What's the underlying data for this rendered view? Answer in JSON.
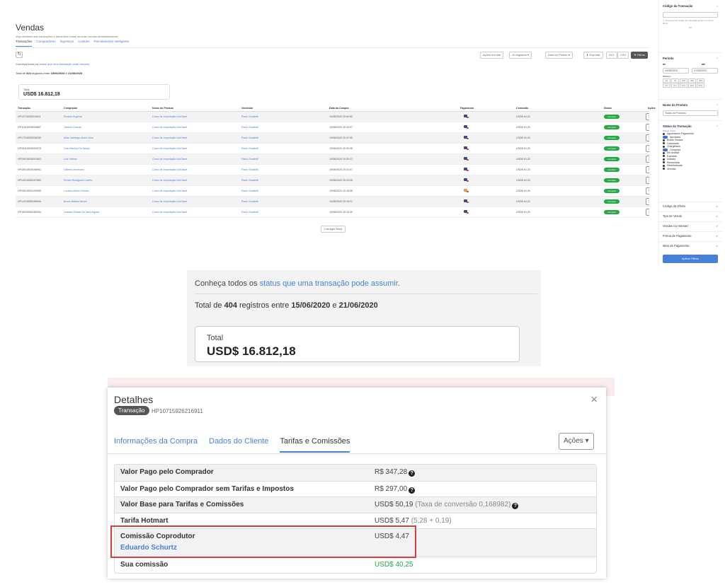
{
  "page": {
    "title": "Vendas",
    "subtitle": "Veja detalhes das transações e administre todas as suas vendas detalhadamente",
    "tabs": [
      "Transações",
      "Compradores",
      "Ingressos",
      "Cookies",
      "Parcelamento Inteligente"
    ],
    "toolbar": {
      "refresh": "↻",
      "acoes_em_lote": "Ações em lote",
      "registros": "10 registros ▾",
      "data_pedido": "Data do Pedido ▾",
      "exportar": "⬇ Exportar",
      "xls": "XLS",
      "csv": "CSV",
      "filtros": "▼ Filtros"
    },
    "status_info_prefix": "Conheça todos os ",
    "status_info_link": "status que uma transação pode assumir",
    "status_info_suffix": ".",
    "total_text_prefix": "Total de ",
    "total_count": "404",
    "total_text_mid": " registros entre ",
    "date_from": "15/06/2020",
    "total_text_and": " e ",
    "date_to": "21/06/2020",
    "total_label": "Total",
    "total_value": "USD$ 16.812,18",
    "load_more": "Carregar Mais"
  },
  "table": {
    "headers": [
      "Transação",
      "Comprador",
      "Nome do Produto",
      "Vendedor",
      "Data da Compra",
      "Pagamento",
      "Comissão",
      "Status",
      "Ações"
    ],
    "rows": [
      [
        "HP10715926216911",
        "Ricardo Argenta",
        "Curso de Importação UniOsset",
        "Paulo Socaletti",
        "19/06/2020 20:54:52",
        "USD$ 40,25",
        "Completo"
      ],
      [
        "HP11515926209867",
        "Yasmin Chavali",
        "Curso de Importação UniOsset",
        "Paulo Socaletti",
        "19/06/2020 20:43:07",
        "USD$ 40,25",
        "Completo"
      ],
      [
        "HP17315926208259",
        "Allan Santiago Alves Lima",
        "Curso de Importação UniOsset",
        "Paulo Socaletti",
        "19/06/2020 20:37:05",
        "USD$ 40,25",
        "Completo"
      ],
      [
        "HP18115926202075",
        "Caio Marcus Da Araújo",
        "Curso de Importação UniOsset",
        "Paulo Socaletti",
        "19/06/2020 20:30:08",
        "USD$ 40,25",
        "Completo"
      ],
      [
        "HP19615926201603",
        "Luiz Velloso",
        "Curso de Importação UniOsset",
        "Paulo Socaletti",
        "19/06/2020 20:29:21",
        "USD$ 40,25",
        "Completo"
      ],
      [
        "HP18515926198961",
        "Gilberto Anomano",
        "Curso de Importação UniOsset",
        "Paulo Socaletti",
        "19/06/2020 20:24:57",
        "USD$ 40,25",
        "Completo"
      ],
      [
        "HP14015926197852",
        "Renan Rodrigues Coelho",
        "Curso de Importação UniOsset",
        "Paulo Socaletti",
        "19/06/2020 20:23:06",
        "USD$ 40,25",
        "Completo"
      ],
      [
        "HP15615926195365",
        "Luciano Abreu Gomes",
        "Curso de Importação UniOsset",
        "Paulo Socaletti",
        "19/06/2020 20:18:56",
        "USD$ 40,25",
        "Completo"
      ],
      [
        "HP14215926189006",
        "Bruno Batista Neves",
        "Curso de Importação UniOsset",
        "Paulo Socaletti",
        "19/06/2020 20:18:21",
        "USD$ 40,25",
        "Completo"
      ],
      [
        "HP16915926185394",
        "Leandro Rafael De Melo Aguiar",
        "Curso de Importação UniOsset",
        "Paulo Socaletti",
        "19/06/2020 20:15:39",
        "USD$ 40,25",
        "Completo"
      ]
    ]
  },
  "filters": {
    "codigo_transacao": "Código da Transação",
    "codigo_hint": "Ⓘ É busca pelo código da transação ignora os outros filtros.",
    "codigo_or": "OU",
    "periodo": "Período",
    "de_label": "de",
    "ate_label": "até",
    "de_value": "15/06/2020",
    "ate_value": "21/06/2020",
    "ultimos": "Últimos:",
    "chips_row1": [
      "1d",
      "7d",
      "15d",
      "30d",
      "45d"
    ],
    "chips_row2": [
      "3m",
      "6m",
      "12m",
      "18m",
      "24m"
    ],
    "nome_produto": "Nome do Produto",
    "todos_produtos": "Todos os Produtos",
    "status_transacao": "Status da Transação",
    "marcar_todos": "Marcar Todos",
    "statuses": [
      "Aguardando Pagamento",
      "Aprovada",
      "Boleto Gerado",
      "Cancelada",
      "Chargeback",
      "Completa",
      "Em Análise",
      "Expirada",
      "Iniciada",
      "Reclamada",
      "Reembolsada",
      "Vencida"
    ],
    "collapsed": [
      "Código da Oferta",
      "Tipo de Venda",
      "Vendas na Hotmart",
      "Forma de Pagamento",
      "Meio de Pagamento"
    ],
    "apply": "Aplicar Filtros"
  },
  "modal": {
    "title": "Detalhes",
    "badge": "Transação",
    "code": "HP10715926216911",
    "close": "×",
    "tabs": [
      "Informações da Compra",
      "Dados do Cliente",
      "Tarifas e Comissões"
    ],
    "actions": "Ações ▾",
    "rows": [
      {
        "label": "Valor Pago pelo Comprador",
        "value": "R$ 347,28"
      },
      {
        "label": "Valor Pago pelo Comprador sem Tarifas e Impostos",
        "value": "R$ 297,00"
      },
      {
        "label": "Valor Base para Tarifas e Comissões",
        "value": "USD$ 50,19",
        "extra": "(Taxa de conversão 0,168982)"
      },
      {
        "label": "Tarifa Hotmart",
        "value": "USD$ 5,47",
        "extra": "(5,28 + 0,19)"
      },
      {
        "label": "Comissão Coprodutor",
        "value": "USD$ 4,47",
        "sub": "Eduardo Schurtz"
      },
      {
        "label": "Sua comissão",
        "value": "USD$ 40,25"
      }
    ]
  },
  "colors": {
    "link": "#4a7fd6",
    "success": "#27a844",
    "highlight": "#e03b3b"
  }
}
